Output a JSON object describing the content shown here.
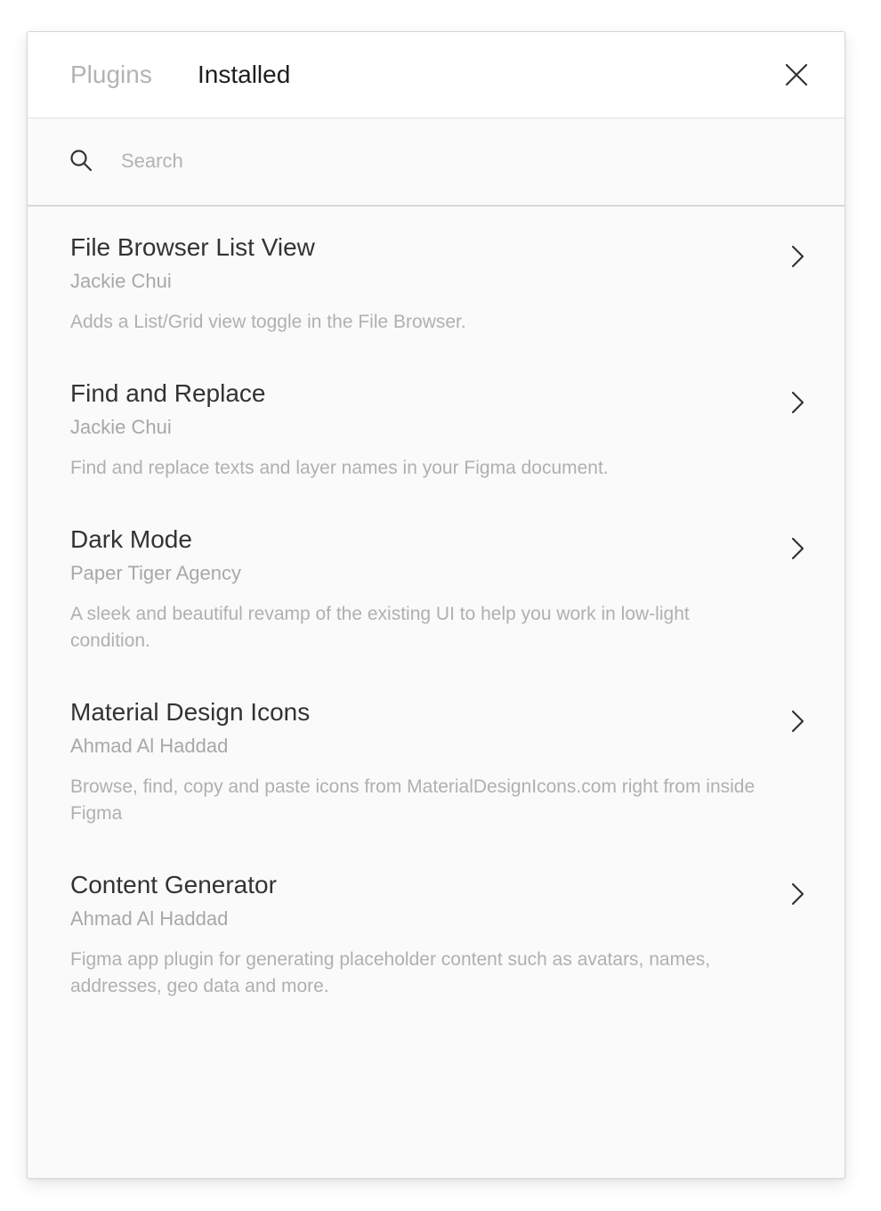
{
  "header": {
    "tabs": [
      {
        "label": "Plugins",
        "active": false
      },
      {
        "label": "Installed",
        "active": true
      }
    ],
    "close_icon": "close-icon"
  },
  "search": {
    "placeholder": "Search",
    "value": "",
    "icon": "search-icon"
  },
  "plugins": [
    {
      "title": "File Browser List View",
      "author": "Jackie Chui",
      "description": "Adds a List/Grid view toggle in the File Browser."
    },
    {
      "title": "Find and Replace",
      "author": "Jackie Chui",
      "description": "Find and replace texts and layer names in your Figma document."
    },
    {
      "title": "Dark Mode",
      "author": "Paper Tiger Agency",
      "description": "A sleek and beautiful revamp of the existing UI to help you work in low-light condition."
    },
    {
      "title": "Material Design Icons",
      "author": "Ahmad Al Haddad",
      "description": "Browse, find, copy and paste icons from MaterialDesignIcons.com right from inside Figma"
    },
    {
      "title": "Content Generator",
      "author": "Ahmad Al Haddad",
      "description": "Figma app plugin for generating placeholder content such as avatars, names, addresses, geo data and more."
    }
  ],
  "colors": {
    "active_tab": "#1e1e1e",
    "inactive_tab": "#b3b3b3",
    "title": "#333333",
    "secondary": "#a8a8a8",
    "panel_bg": "#fafafa"
  }
}
